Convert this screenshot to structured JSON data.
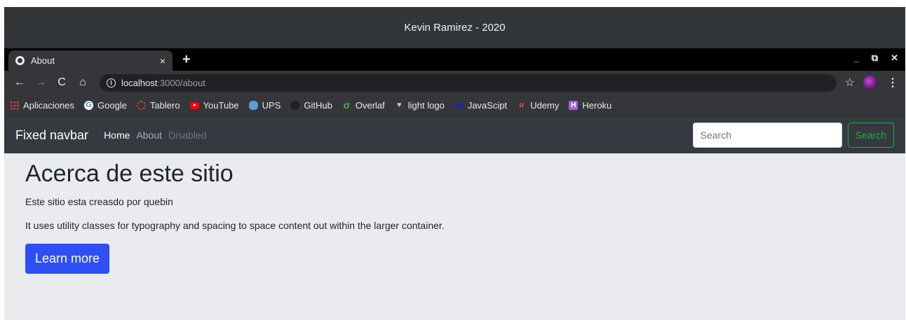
{
  "window": {
    "title": "Kevin Ramirez - 2020",
    "controls": {
      "minimize": "_",
      "restore": "⧉",
      "close": "✕"
    }
  },
  "tabs": [
    {
      "title": "About",
      "close": "×",
      "icon": "globe-icon"
    }
  ],
  "new_tab": "+",
  "toolbar": {
    "back": "←",
    "forward": "→",
    "reload": "C",
    "home": "⌂",
    "info": "i",
    "url_host": "localhost",
    "url_path": ":3000/about",
    "star": "☆",
    "menu": "⋮"
  },
  "bookmarks": [
    {
      "label": "Aplicaciones",
      "icon": "apps-icon",
      "glyph": ""
    },
    {
      "label": "Google",
      "icon": "google-icon",
      "glyph": "G"
    },
    {
      "label": "Tablero",
      "icon": "tablero-icon",
      "glyph": ""
    },
    {
      "label": "YouTube",
      "icon": "youtube-icon",
      "glyph": ""
    },
    {
      "label": "UPS",
      "icon": "ups-icon",
      "glyph": ""
    },
    {
      "label": "GitHub",
      "icon": "github-icon",
      "glyph": ""
    },
    {
      "label": "Overlaf",
      "icon": "overleaf-icon",
      "glyph": "σ"
    },
    {
      "label": "light logo",
      "icon": "light-logo-icon",
      "glyph": "♥"
    },
    {
      "label": "JavaScipt",
      "icon": "javascript-icon",
      "glyph": ""
    },
    {
      "label": "Udemy",
      "icon": "udemy-icon",
      "glyph": "u"
    },
    {
      "label": "Heroku",
      "icon": "heroku-icon",
      "glyph": "H"
    }
  ],
  "navbar": {
    "brand": "Fixed navbar",
    "links": [
      {
        "label": "Home",
        "state": "active"
      },
      {
        "label": "About",
        "state": "normal"
      },
      {
        "label": "Disabled",
        "state": "disabled"
      }
    ],
    "search_placeholder": "Search",
    "search_button": "Search"
  },
  "main": {
    "heading": "Acerca de este sitio",
    "lead": "Este sitio esta creasdo por quebin",
    "body": "It uses utility classes for typography and spacing to space content out within the larger container.",
    "button": "Learn more"
  },
  "colors": {
    "navbar_bg": "#343a40",
    "page_bg": "#e9ebee",
    "primary": "#2d4ff5",
    "success": "#28a745"
  }
}
